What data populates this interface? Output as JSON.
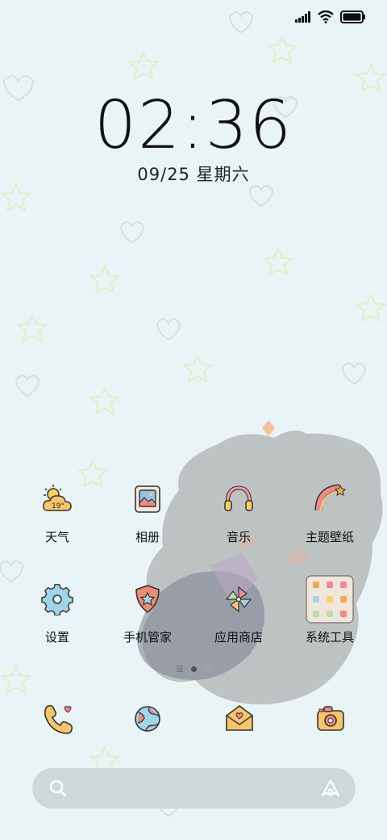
{
  "status_bar": {
    "icons": [
      "signal-icon",
      "wifi-icon",
      "battery-icon"
    ]
  },
  "lockscreen": {
    "time": "02:36",
    "date": "09/25 星期六"
  },
  "apps": [
    {
      "label": "天气",
      "icon": "weather-icon",
      "badge": "19°"
    },
    {
      "label": "相册",
      "icon": "gallery-icon"
    },
    {
      "label": "音乐",
      "icon": "headphones-icon"
    },
    {
      "label": "主题壁纸",
      "icon": "rainbow-icon"
    },
    {
      "label": "设置",
      "icon": "gear-icon"
    },
    {
      "label": "手机管家",
      "icon": "shield-icon"
    },
    {
      "label": "应用商店",
      "icon": "pinwheel-icon"
    },
    {
      "label": "系统工具",
      "icon": "folder-icon"
    }
  ],
  "page_indicator": {
    "pages": 2,
    "active": 1
  },
  "dock": [
    "phone-icon",
    "browser-icon",
    "messages-icon",
    "camera-icon"
  ],
  "search": {
    "icons": [
      "search-icon",
      "assistant-icon"
    ]
  },
  "colors": {
    "background": "#e9f4f6",
    "search_bar": "#ccd8da",
    "accent_orange": "#f4a64a",
    "accent_pink": "#f08a8a"
  }
}
